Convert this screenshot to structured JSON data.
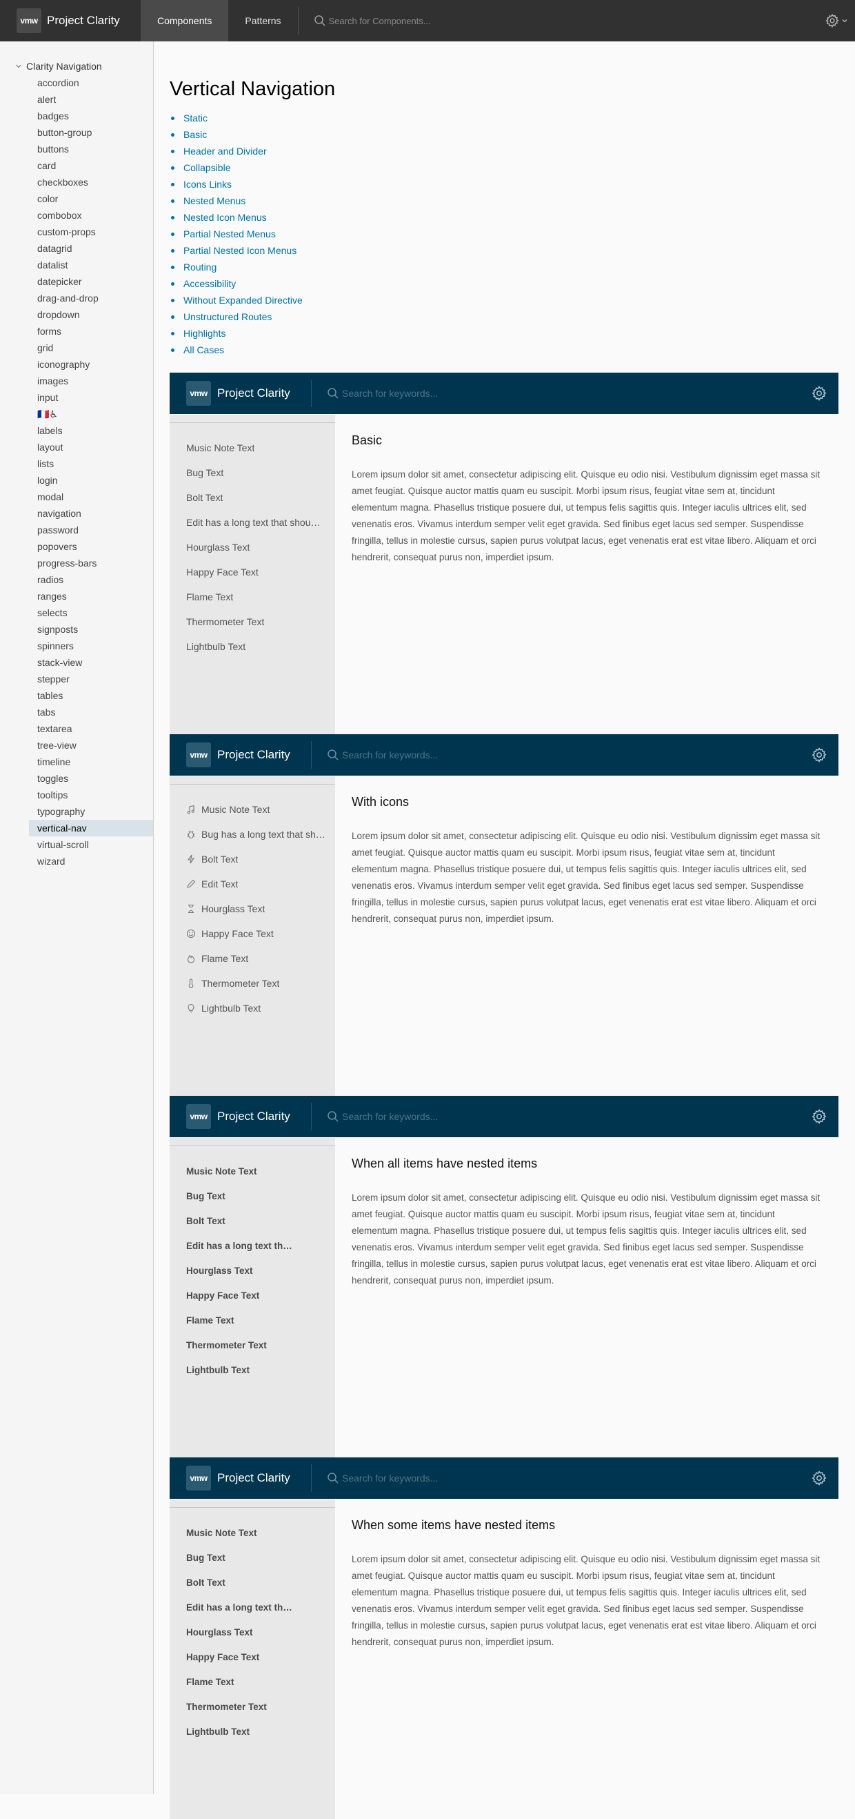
{
  "app": {
    "logo": "vmw",
    "title": "Project Clarity",
    "tabs": [
      "Components",
      "Patterns"
    ],
    "search_placeholder": "Search for Components..."
  },
  "sidebar": {
    "group_label": "Clarity Navigation",
    "items": [
      "accordion",
      "alert",
      "badges",
      "button-group",
      "buttons",
      "card",
      "checkboxes",
      "color",
      "combobox",
      "custom-props",
      "datagrid",
      "datalist",
      "datepicker",
      "drag-and-drop",
      "dropdown",
      "forms",
      "grid",
      "iconography",
      "images",
      "input",
      "🇫🇷♿",
      "labels",
      "layout",
      "lists",
      "login",
      "modal",
      "navigation",
      "password",
      "popovers",
      "progress-bars",
      "radios",
      "ranges",
      "selects",
      "signposts",
      "spinners",
      "stack-view",
      "stepper",
      "tables",
      "tabs",
      "textarea",
      "tree-view",
      "timeline",
      "toggles",
      "tooltips",
      "typography",
      "vertical-nav",
      "virtual-scroll",
      "wizard"
    ],
    "active_item": "vertical-nav"
  },
  "page": {
    "title": "Vertical Navigation",
    "links": [
      "Static",
      "Basic",
      "Header and Divider",
      "Collapsible",
      "Icons Links",
      "Nested Menus",
      "Nested Icon Menus",
      "Partial Nested Menus",
      "Partial Nested Icon Menus",
      "Routing",
      "Accessibility",
      "Without Expanded Directive",
      "Unstructured Routes",
      "Highlights",
      "All Cases"
    ]
  },
  "demo_header": {
    "logo": "vmw",
    "title": "Project Clarity",
    "search_placeholder": "Search for keywords..."
  },
  "lorem": "Lorem ipsum dolor sit amet, consectetur adipiscing elit. Quisque eu odio nisi. Vestibulum dignissim eget massa sit amet feugiat. Quisque auctor mattis quam eu suscipit. Morbi ipsum risus, feugiat vitae sem at, tincidunt elementum magna. Phasellus tristique posuere dui, ut tempus felis sagittis quis. Integer iaculis ultrices elit, sed venenatis eros. Vivamus interdum semper velit eget gravida. Sed finibus eget lacus sed semper. Suspendisse fringilla, tellus in molestie cursus, sapien purus volutpat lacus, eget venenatis erat est vitae libero. Aliquam et orci hendrerit, consequat purus non, imperdiet ipsum.",
  "demos": [
    {
      "heading": "Basic",
      "nav": [
        "Music Note Text",
        "Bug Text",
        "Bolt Text",
        "Edit has a long text that should be truncated",
        "Hourglass Text",
        "Happy Face Text",
        "Flame Text",
        "Thermometer Text",
        "Lightbulb Text"
      ]
    },
    {
      "heading": "With icons",
      "nav": [
        "Music Note Text",
        "Bug has a long text that should be truncated",
        "Bolt Text",
        "Edit Text",
        "Hourglass Text",
        "Happy Face Text",
        "Flame Text",
        "Thermometer Text",
        "Lightbulb Text"
      ],
      "icons": [
        "music-note-icon",
        "bug-icon",
        "bolt-icon",
        "pencil-icon",
        "hourglass-icon",
        "happy-face-icon",
        "flame-icon",
        "thermometer-icon",
        "lightbulb-icon"
      ]
    },
    {
      "heading": "When all items have nested items",
      "nav": [
        "Music Note Text",
        "Bug Text",
        "Bolt Text",
        "Edit has a long text that should be truncated",
        "Hourglass Text",
        "Happy Face Text",
        "Flame Text",
        "Thermometer Text",
        "Lightbulb Text"
      ]
    },
    {
      "heading": "When some items have nested items",
      "nav": [
        "Music Note Text",
        "Bug Text",
        "Bolt Text",
        "Edit has a long text that should be truncated",
        "Hourglass Text",
        "Happy Face Text",
        "Flame Text",
        "Thermometer Text",
        "Lightbulb Text"
      ]
    }
  ],
  "colors": {
    "app_header": "#313131",
    "demo_header": "#003550",
    "link": "#0072a3",
    "sidebar_active": "#d8e3e9",
    "vnav_bg": "#e8e8e8"
  }
}
